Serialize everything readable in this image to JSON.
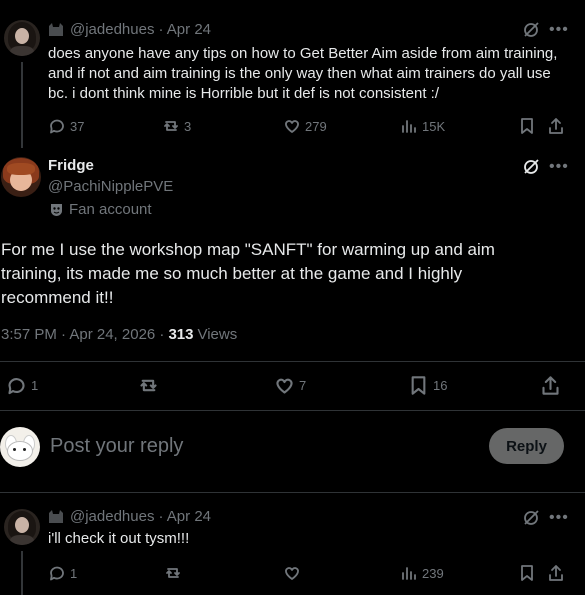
{
  "parent_tweet": {
    "handle": "@jadedhues",
    "date": "· Apr 24",
    "text": "does anyone have any tips on how to Get Better Aim aside from aim training, and if not and aim training is the only way then what aim trainers do yall use bc. i dont think mine is Horrible but it def is not consistent :/",
    "replies": "37",
    "reposts": "3",
    "likes": "279",
    "views": "15K"
  },
  "main_tweet": {
    "name": "Fridge",
    "username": "@PachiNipplePVE",
    "badge": "Fan account",
    "text": "For me I use the workshop map \"SANFT\" for warming up and aim training, its made me so much better at the game and I highly recommend it!!",
    "time": "3:57 PM · Apr 24, 2026 ·",
    "views_count": "313",
    "views_label": "Views",
    "replies": "1",
    "reposts": "",
    "likes": "7",
    "bookmarks": "16"
  },
  "composer": {
    "placeholder": "Post your reply",
    "button": "Reply"
  },
  "reply_tweet": {
    "handle": "@jadedhues",
    "date": "· Apr 24",
    "text": "i'll check it out tysm!!!",
    "replies": "1",
    "reposts": "",
    "likes": "",
    "views": "239"
  },
  "icons": {
    "menu": "more-dots-icon",
    "grok": "grok-icon"
  }
}
